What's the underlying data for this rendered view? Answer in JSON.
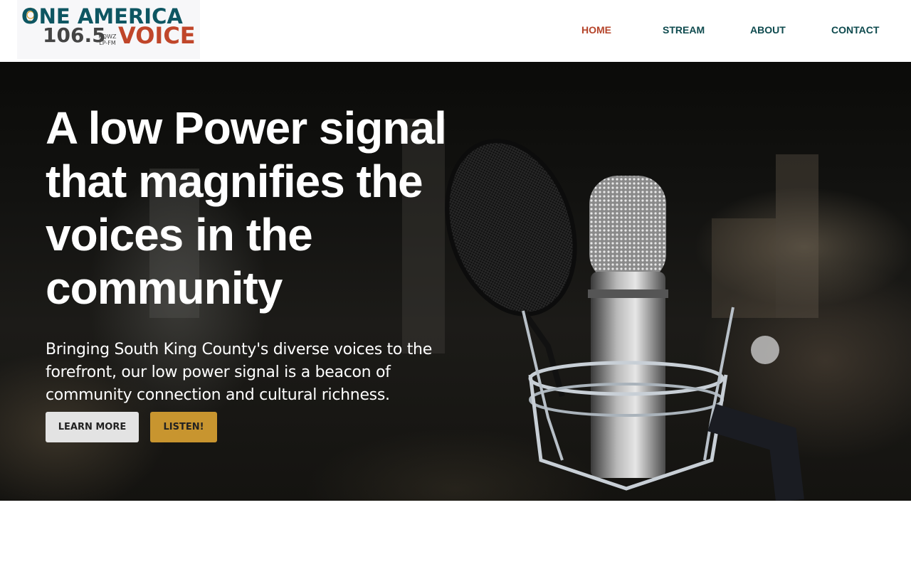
{
  "logo": {
    "line1": "ONE AMERICA",
    "frequency": "106.5",
    "call_sign_top": "KQWZ",
    "call_sign_bottom": "LP-FM",
    "voice": "VOICE",
    "icon": "gear-icon"
  },
  "nav": {
    "items": [
      {
        "label": "HOME",
        "active": true
      },
      {
        "label": "STREAM",
        "active": false
      },
      {
        "label": "ABOUT",
        "active": false
      },
      {
        "label": "CONTACT",
        "active": false
      }
    ]
  },
  "hero": {
    "title": "A low Power signal that magnifies the voices in the community",
    "text": "Bringing South King County's diverse voices to the forefront, our low power signal is a beacon of community connection and cultural richness.",
    "buttons": {
      "learn_more": "LEARN MORE",
      "listen": "LISTEN!"
    },
    "background_image": "studio-microphone-photo"
  },
  "colors": {
    "brand_teal": "#0e5662",
    "brand_orange": "#c0462a",
    "brand_gold": "#c8952f",
    "nav_text": "#0e4a4e",
    "nav_active": "#b5442a",
    "button_light": "#e3e3e3"
  }
}
